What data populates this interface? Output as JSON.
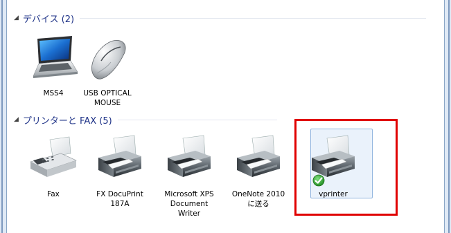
{
  "devices_group": {
    "title": "デバイス (2)"
  },
  "printers_group": {
    "title": "プリンターと FAX (5)"
  },
  "devices": [
    {
      "label": "MSS4",
      "icon": "laptop-icon"
    },
    {
      "label": "USB OPTICAL MOUSE",
      "icon": "mouse-icon"
    }
  ],
  "printers": [
    {
      "label": "Fax",
      "icon": "fax-icon"
    },
    {
      "label": "FX DocuPrint 187A",
      "icon": "printer-icon"
    },
    {
      "label": "Microsoft XPS Document Writer",
      "icon": "printer-icon"
    },
    {
      "label": "OneNote 2010 に送る",
      "icon": "printer-icon"
    },
    {
      "label": "vprinter",
      "icon": "printer-icon",
      "default": true
    }
  ],
  "colors": {
    "group_title": "#1e3287",
    "highlight": "#e00000",
    "selection_bg": "#eaf2fb",
    "default_check": "#2f9a2f"
  }
}
